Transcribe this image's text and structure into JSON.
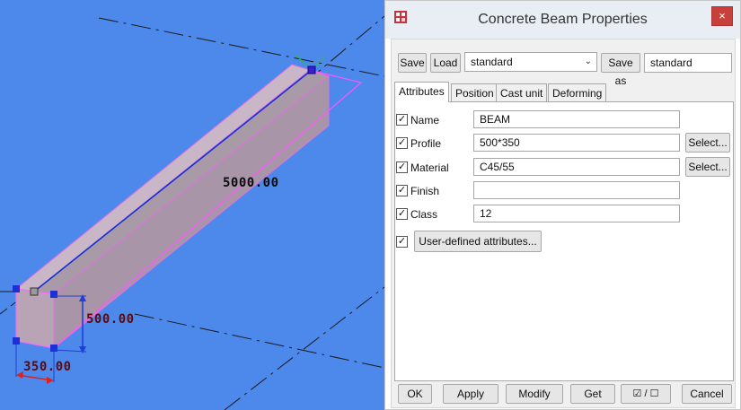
{
  "viewport": {
    "dimensions": {
      "length": "5000.00",
      "height": "500.00",
      "width": "350.00"
    }
  },
  "dialog": {
    "title": "Concrete Beam Properties",
    "close_glyph": "×",
    "toolbar": {
      "save_label": "Save",
      "load_label": "Load",
      "load_value": "standard",
      "save_as_label": "Save as",
      "save_as_value": "standard"
    },
    "tabs": [
      "Attributes",
      "Position",
      "Cast unit",
      "Deforming"
    ],
    "attributes": {
      "name_label": "Name",
      "name_value": "BEAM",
      "profile_label": "Profile",
      "profile_value": "500*350",
      "material_label": "Material",
      "material_value": "C45/55",
      "finish_label": "Finish",
      "finish_value": "",
      "class_label": "Class",
      "class_value": "12",
      "select_label": "Select...",
      "uda_label": "User-defined attributes...",
      "check_glyph": "✓"
    },
    "footer": {
      "ok": "OK",
      "apply": "Apply",
      "modify": "Modify",
      "get": "Get",
      "toggle": "☑ / ☐",
      "cancel": "Cancel"
    }
  },
  "colors": {
    "viewport_bg": "#4d89ea",
    "beam_fill": "#b9a4b6",
    "beam_edge": "#ff66ff",
    "dim_line": "#1f3fd6",
    "dim_red": "#e02020"
  }
}
